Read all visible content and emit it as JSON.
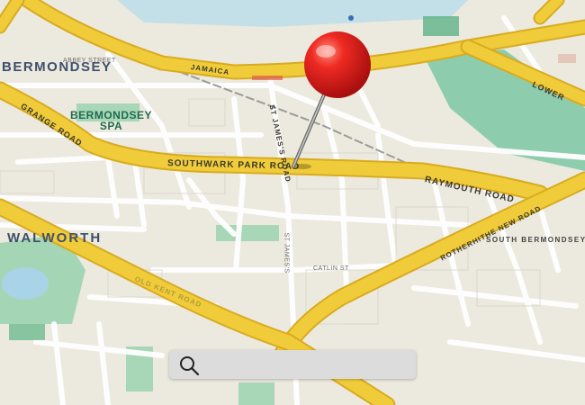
{
  "map": {
    "districts": {
      "bermondsey": "BERMONDSEY",
      "walworth": "WALWORTH"
    },
    "parks": {
      "bermondsey_spa_line1": "BERMONDSEY",
      "bermondsey_spa_line2": "SPA"
    },
    "roads": {
      "southwark_park_road": "SOUTHWARK PARK ROAD",
      "raymouth_road": "RAYMOUTH ROAD",
      "grange_road": "GRANGE ROAD",
      "st_james_road": "ST JAMES'S ROAD",
      "rotherhithe_new_road": "ROTHERHITHE NEW ROAD",
      "abbey_street": "ABBEY STREET",
      "jamaica": "JAMAICA",
      "lower": "LOWER",
      "catlin_st": "CATLIN ST",
      "old_kent_road": "OLD KENT ROAD",
      "south_bermondsey": "SOUTH BERMONDSEY",
      "st_james_lower": "ST JAMES'S"
    },
    "colors": {
      "land": "#ece9de",
      "road_major": "#f1cc3a",
      "road_casing": "#d8ab1f",
      "park": "#7cc7a4",
      "water": "#a9d3e6",
      "pin_head": "#e01e1e"
    }
  },
  "search": {
    "placeholder": "",
    "value": ""
  },
  "icons": {
    "search": "search-icon",
    "pin": "map-pin-icon"
  }
}
